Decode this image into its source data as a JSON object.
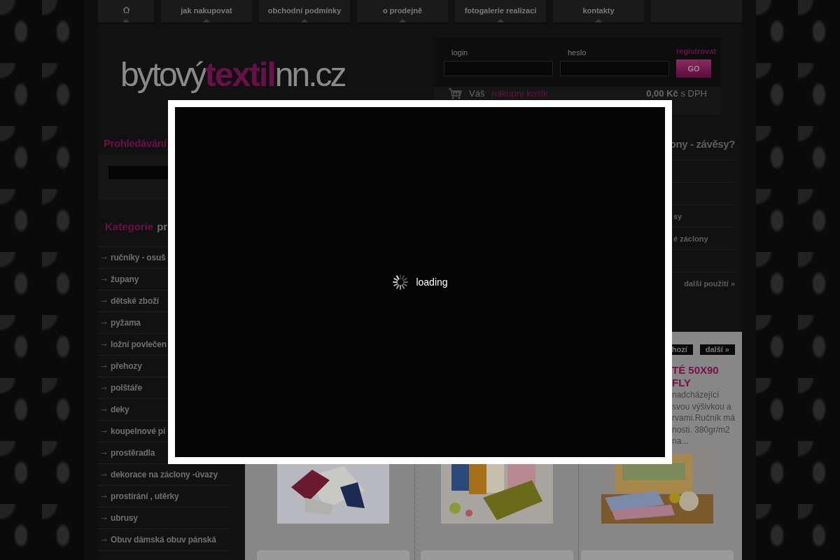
{
  "nav": {
    "items": [
      {
        "kind": "home"
      },
      {
        "kind": "text",
        "label": "jak nakupovat"
      },
      {
        "kind": "text",
        "label": "obchodní podmínky"
      },
      {
        "kind": "text",
        "label": "o prodejně"
      },
      {
        "kind": "text",
        "label": "fotogalerie realizaci"
      },
      {
        "kind": "text",
        "label": "kontakty"
      },
      {
        "kind": "blank"
      }
    ]
  },
  "logo": {
    "part_1": "bytový",
    "part_2": "textil",
    "part_3": "nn.cz"
  },
  "login": {
    "login_label": "login",
    "password_label": "heslo",
    "register_link": "registrovat",
    "submit": "GO"
  },
  "cart": {
    "prefix": "Váš",
    "link": "nákupní košík",
    "total": "0,00 Kč",
    "total_suffix": "s DPH"
  },
  "search": {
    "heading": "Prohledávání"
  },
  "categories": {
    "heading_accent": "Kategorie",
    "heading_rest": "pr",
    "items": [
      "ručníky - osuš",
      "župany",
      "dětské zboží",
      "pyžama",
      "ložní povlečen",
      "přehozy",
      "polštáře",
      "deky",
      "koupelnové pi",
      "prostěradla",
      "dekorace na záclony -úvazy",
      "prostírání , utěrky",
      "ubrusy",
      "Obuv dámská obuv pánská"
    ]
  },
  "uses": {
    "heading": "ony - závěsy?",
    "rows": [
      {
        "kind": "blank"
      },
      {
        "kind": "blank"
      },
      {
        "kind": "text",
        "label": "sy"
      },
      {
        "kind": "text",
        "label": "é záclony"
      },
      {
        "kind": "blank"
      }
    ],
    "more_link": "další použití »"
  },
  "products": {
    "pager": [
      "hozí",
      "další »"
    ],
    "items": [
      {
        "kind": "picture"
      },
      {
        "kind": "picture"
      },
      {
        "kind": "picture",
        "title_lines": [
          "TÉ 50X90",
          "FLY"
        ],
        "description_lines": [
          "nadcházející",
          "svou výšivkou a",
          "rvami.Ručník má",
          "nosti. 380gr/m2",
          "na..."
        ]
      }
    ]
  },
  "modal": {
    "message": "loading"
  }
}
